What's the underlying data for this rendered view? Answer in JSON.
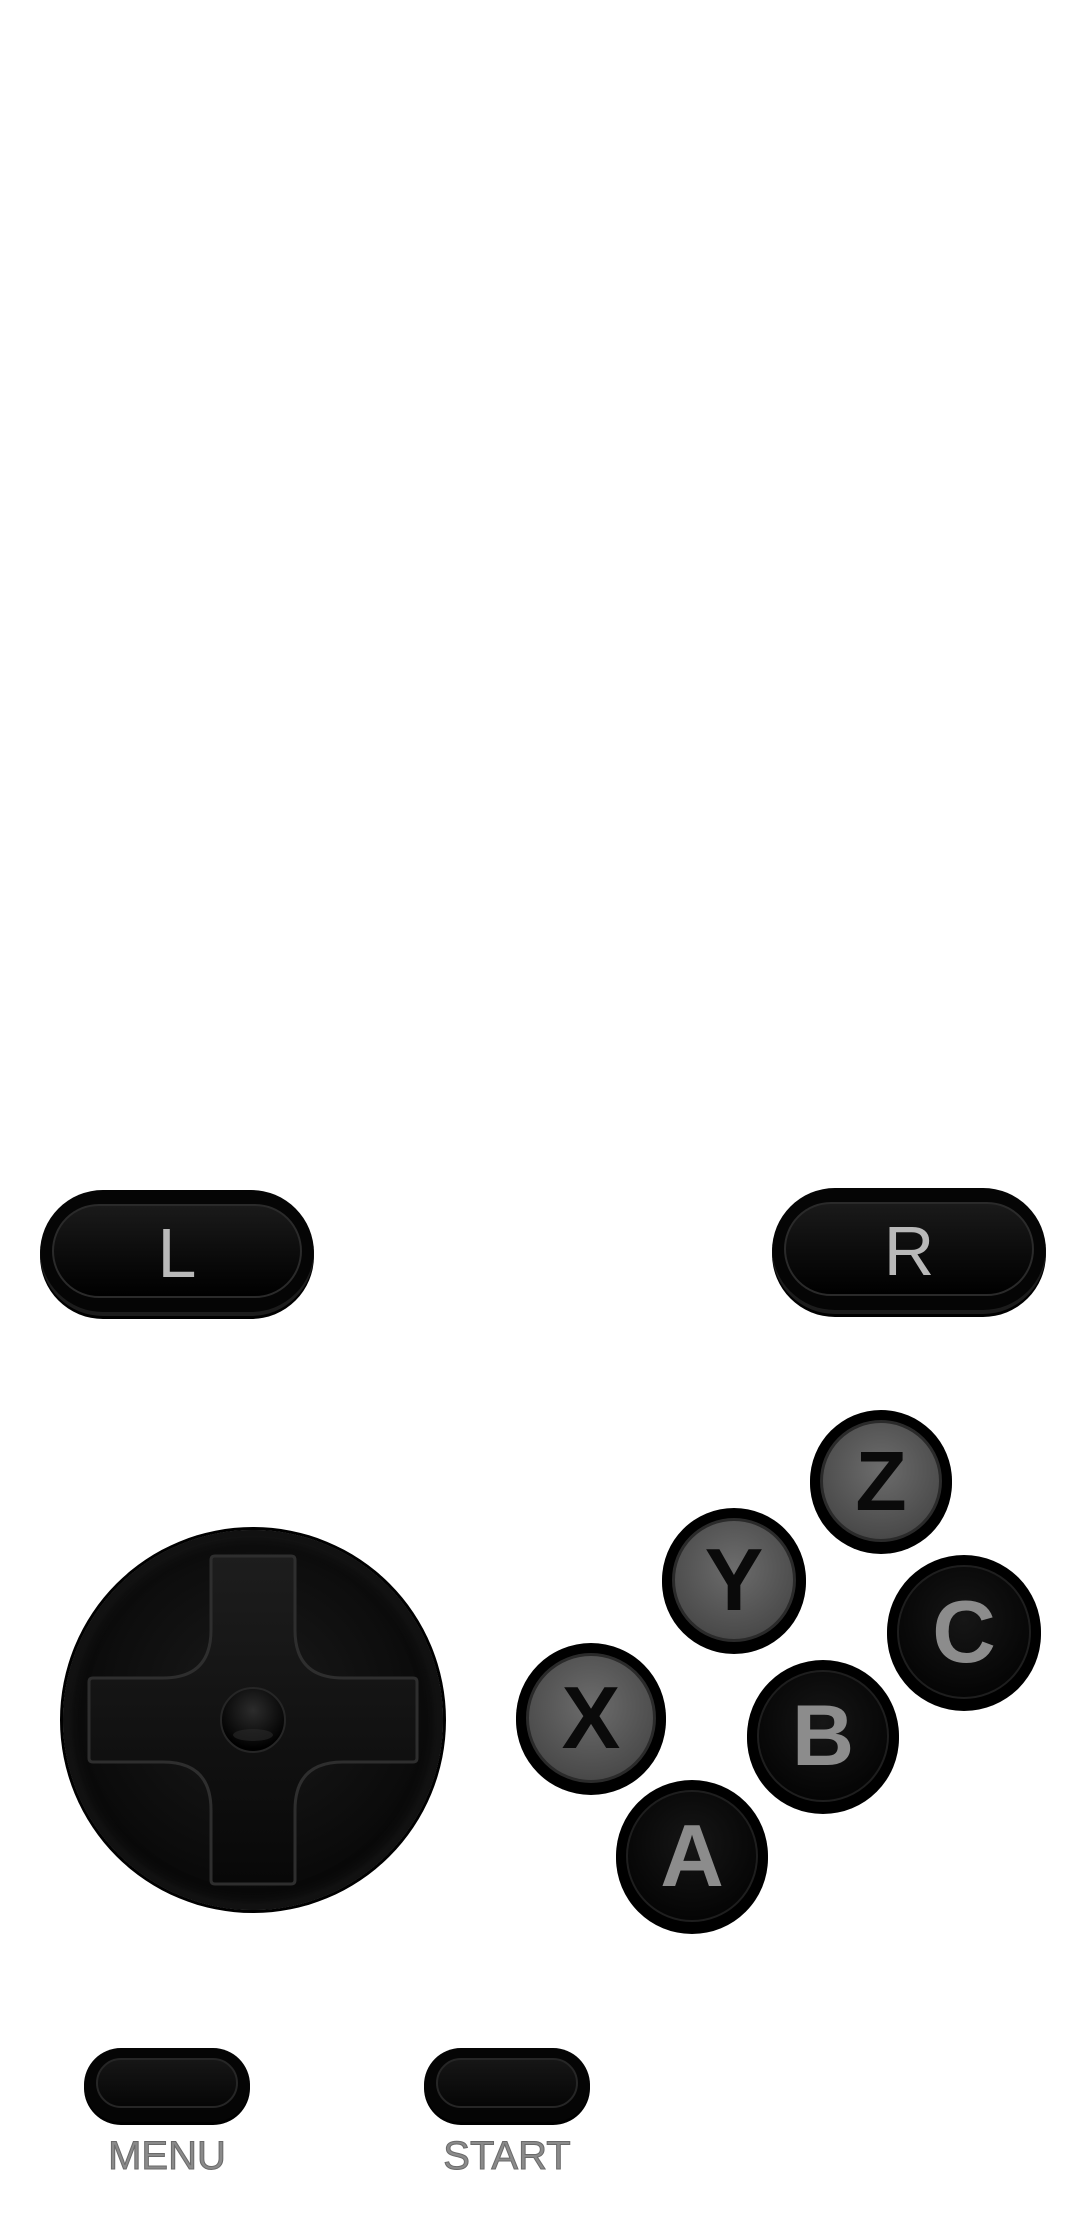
{
  "shoulder_buttons": {
    "left": "L",
    "right": "R"
  },
  "face_buttons": {
    "z": "Z",
    "y": "Y",
    "c": "C",
    "x": "X",
    "b": "B",
    "a": "A"
  },
  "system_buttons": {
    "menu_label": "MENU",
    "start_label": "START"
  },
  "colors": {
    "background": "#ffffff",
    "button_body": "#050505",
    "light_cap": "#5a5a5a",
    "label_gray": "#8a8a8a"
  },
  "icons": {
    "dpad": "dpad-cross-icon"
  }
}
